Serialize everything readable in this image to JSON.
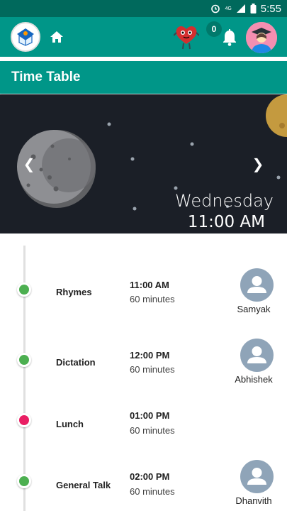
{
  "status_bar": {
    "time": "5:55",
    "network": "4G"
  },
  "app_bar": {
    "icons": [
      "app-logo-icon",
      "home-icon",
      "heart-mascot-icon",
      "bell-icon",
      "profile-avatar"
    ],
    "notification_count": "0"
  },
  "page": {
    "title": "Time Table"
  },
  "banner": {
    "day": "Wednesday",
    "time": "11:00 AM"
  },
  "timetable": [
    {
      "subject": "Rhymes",
      "time": "11:00 AM",
      "duration": "60 minutes",
      "teacher": "Samyak",
      "status_color": "#4caf50",
      "has_teacher": true
    },
    {
      "subject": "Dictation",
      "time": "12:00 PM",
      "duration": "60 minutes",
      "teacher": "Abhishek",
      "status_color": "#4caf50",
      "has_teacher": true
    },
    {
      "subject": "Lunch",
      "time": "01:00 PM",
      "duration": "60 minutes",
      "teacher": "",
      "status_color": "#e91e63",
      "has_teacher": false
    },
    {
      "subject": "General Talk",
      "time": "02:00 PM",
      "duration": "60 minutes",
      "teacher": "Dhanvith",
      "status_color": "#4caf50",
      "has_teacher": true
    }
  ],
  "colors": {
    "primary": "#009688",
    "primary_dark": "#00695c",
    "banner_bg": "#1b1f27",
    "active_dot": "#4caf50",
    "break_dot": "#e91e63"
  }
}
